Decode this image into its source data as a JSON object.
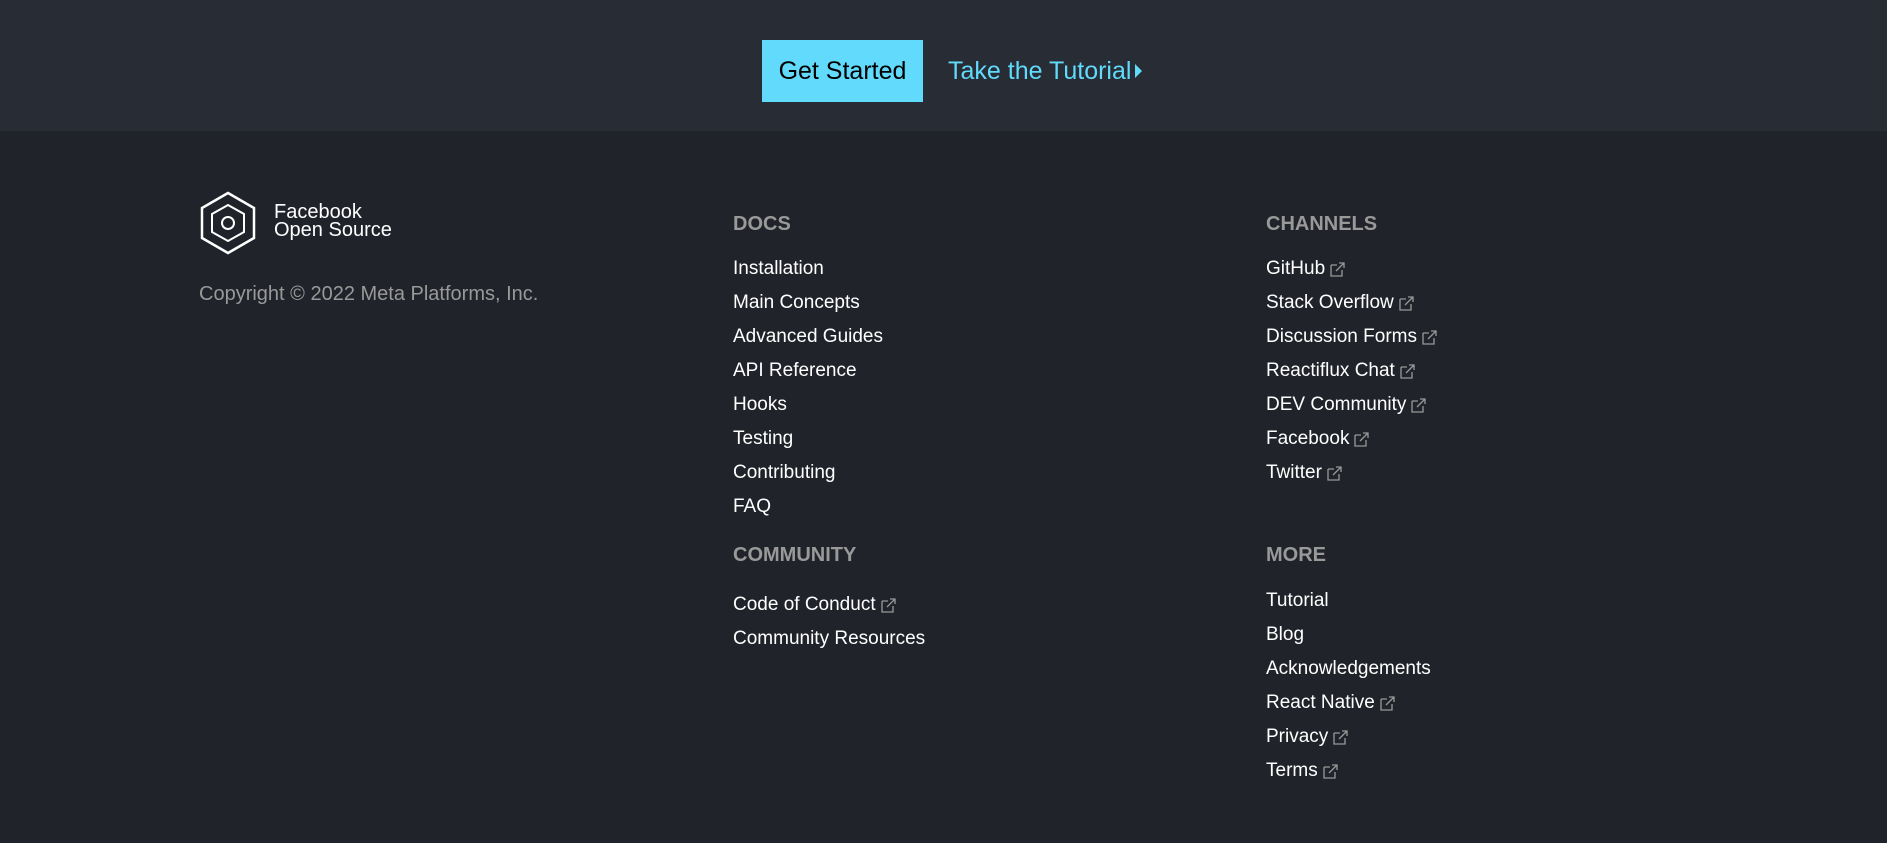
{
  "cta": {
    "primary_label": "Get Started",
    "secondary_label": "Take the Tutorial"
  },
  "brand": {
    "line1": "Facebook",
    "line2": "Open Source",
    "copyright": "Copyright © 2022 Meta Platforms, Inc."
  },
  "docs": {
    "heading": "DOCS",
    "items": [
      {
        "label": "Installation",
        "external": false
      },
      {
        "label": "Main Concepts",
        "external": false
      },
      {
        "label": "Advanced Guides",
        "external": false
      },
      {
        "label": "API Reference",
        "external": false
      },
      {
        "label": "Hooks",
        "external": false
      },
      {
        "label": "Testing",
        "external": false
      },
      {
        "label": "Contributing",
        "external": false
      },
      {
        "label": "FAQ",
        "external": false
      }
    ]
  },
  "channels": {
    "heading": "CHANNELS",
    "items": [
      {
        "label": "GitHub",
        "external": true
      },
      {
        "label": "Stack Overflow",
        "external": true
      },
      {
        "label": "Discussion Forms",
        "external": true
      },
      {
        "label": "Reactiflux Chat",
        "external": true
      },
      {
        "label": "DEV Community",
        "external": true
      },
      {
        "label": "Facebook",
        "external": true
      },
      {
        "label": "Twitter",
        "external": true
      }
    ]
  },
  "community": {
    "heading": "COMMUNITY",
    "items": [
      {
        "label": "Code of Conduct",
        "external": true
      },
      {
        "label": "Community Resources",
        "external": false
      }
    ]
  },
  "more": {
    "heading": "MORE",
    "items": [
      {
        "label": "Tutorial",
        "external": false
      },
      {
        "label": "Blog",
        "external": false
      },
      {
        "label": "Acknowledgements",
        "external": false
      },
      {
        "label": "React Native",
        "external": true
      },
      {
        "label": "Privacy",
        "external": true
      },
      {
        "label": "Terms",
        "external": true
      }
    ]
  },
  "colors": {
    "accent": "#61dafb",
    "footer_bg": "#20232a",
    "cta_bg": "#282c34",
    "heading": "#999999",
    "link": "#ffffff"
  },
  "icons": {
    "external_link": "external-link-icon",
    "logo": "facebook-open-source-logo",
    "arrow": "triangle-right-icon"
  }
}
